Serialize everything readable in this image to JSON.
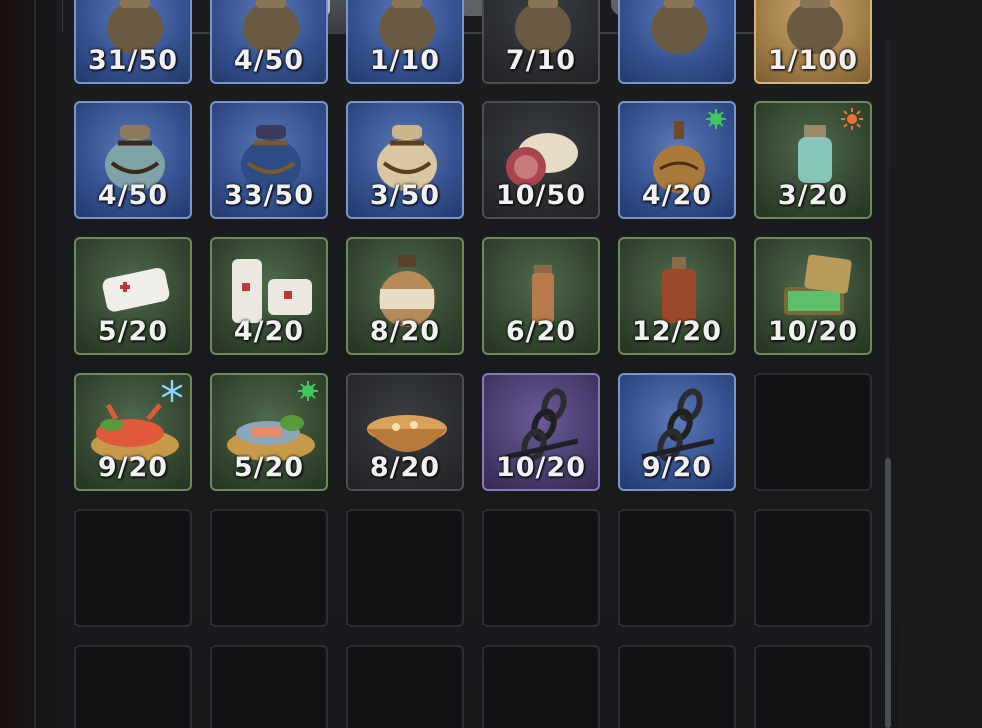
{
  "tabs": [
    {
      "icon": "bag-icon",
      "active": true
    },
    {
      "icon": "badge-icon",
      "active": false
    },
    {
      "icon": "circle-emblem-icon",
      "active": false
    }
  ],
  "inventory": {
    "rows": [
      [
        {
          "rarity": "blue",
          "item": "pouch",
          "qty": "31/50",
          "partial": true
        },
        {
          "rarity": "blue",
          "item": "pouch",
          "qty": "4/50",
          "partial": true
        },
        {
          "rarity": "blue",
          "item": "pouch",
          "qty": "1/10",
          "partial": true
        },
        {
          "rarity": "grey",
          "item": "pouch",
          "qty": "7/10",
          "partial": true
        },
        {
          "rarity": "blue",
          "item": "pouch",
          "qty": "",
          "partial": true
        },
        {
          "rarity": "gold",
          "item": "pouch",
          "qty": "1/100",
          "partial": true
        }
      ],
      [
        {
          "rarity": "blue",
          "item": "teal-sack",
          "qty": "4/50"
        },
        {
          "rarity": "blue",
          "item": "blue-sack",
          "qty": "33/50"
        },
        {
          "rarity": "blue",
          "item": "cream-sack",
          "qty": "3/50"
        },
        {
          "rarity": "grey",
          "item": "meat",
          "qty": "10/50"
        },
        {
          "rarity": "blue",
          "item": "gourd",
          "qty": "4/20",
          "badge": "green-virus-icon"
        },
        {
          "rarity": "green",
          "item": "potion",
          "qty": "3/20",
          "badge": "sun-icon"
        }
      ],
      [
        {
          "rarity": "green",
          "item": "bandage-scroll",
          "qty": "5/20"
        },
        {
          "rarity": "green",
          "item": "bandage-roll",
          "qty": "4/20"
        },
        {
          "rarity": "green",
          "item": "wrapped-jug",
          "qty": "8/20"
        },
        {
          "rarity": "green",
          "item": "small-vial",
          "qty": "6/20"
        },
        {
          "rarity": "green",
          "item": "brown-bottle",
          "qty": "12/20"
        },
        {
          "rarity": "green",
          "item": "open-box",
          "qty": "10/20"
        }
      ],
      [
        {
          "rarity": "green",
          "item": "lobster-plate",
          "qty": "9/20",
          "badge": "snowflake-icon"
        },
        {
          "rarity": "green",
          "item": "fish-plate",
          "qty": "5/20",
          "badge": "green-virus-icon"
        },
        {
          "rarity": "grey",
          "item": "soup-bowl",
          "qty": "8/20"
        },
        {
          "rarity": "purple",
          "item": "chain",
          "qty": "10/20"
        },
        {
          "rarity": "blue",
          "item": "chain",
          "qty": "9/20"
        },
        {
          "rarity": "empty"
        }
      ],
      [
        {
          "rarity": "empty"
        },
        {
          "rarity": "empty"
        },
        {
          "rarity": "empty"
        },
        {
          "rarity": "empty"
        },
        {
          "rarity": "empty"
        },
        {
          "rarity": "empty"
        }
      ],
      [
        {
          "rarity": "empty"
        },
        {
          "rarity": "empty"
        },
        {
          "rarity": "empty"
        },
        {
          "rarity": "empty"
        },
        {
          "rarity": "empty"
        },
        {
          "rarity": "empty"
        }
      ]
    ]
  },
  "scroll": {
    "position": 0.75
  }
}
